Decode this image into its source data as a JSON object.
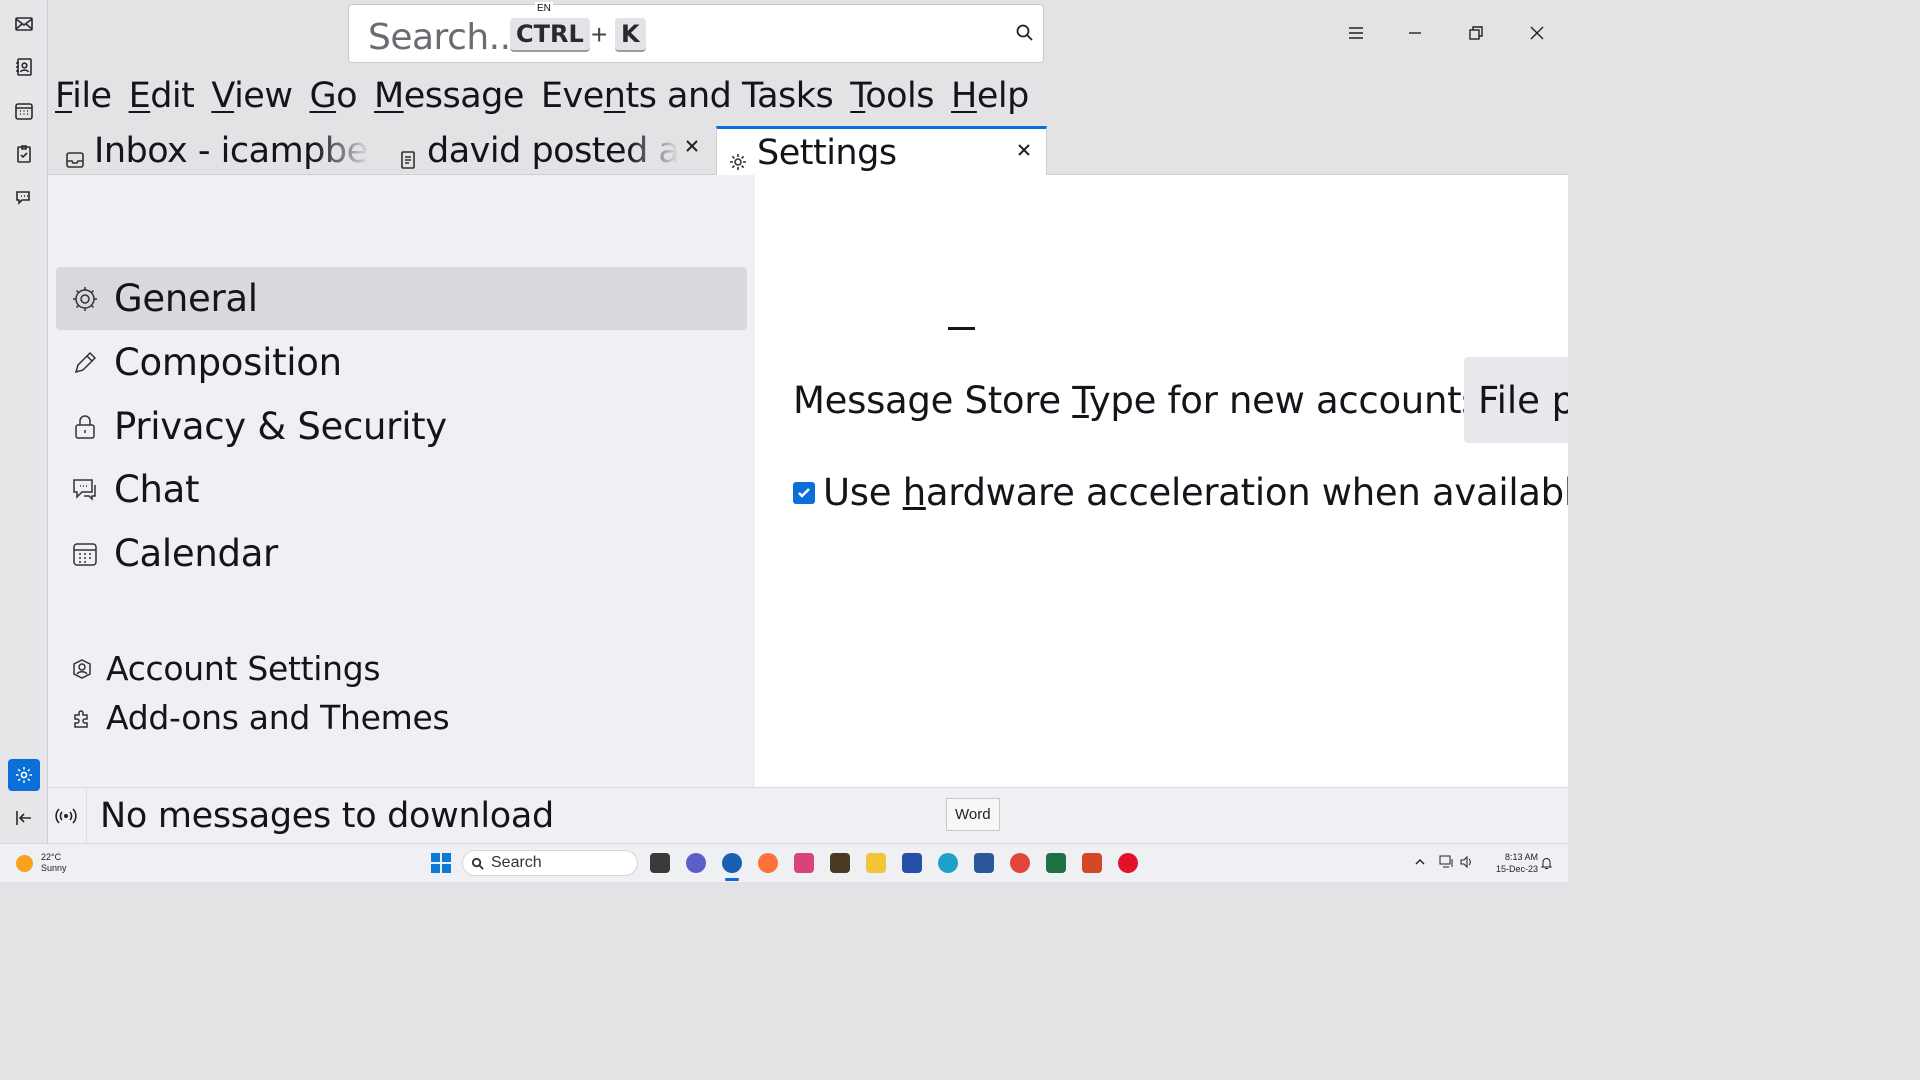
{
  "window": {
    "search_placeholder": "Search...",
    "search_key_1": "CTRL",
    "search_key_plus": "+",
    "search_key_2": "K",
    "ime_indicator": "EN"
  },
  "menubar": {
    "items": [
      {
        "pre": "",
        "u": "F",
        "post": "ile"
      },
      {
        "pre": "",
        "u": "E",
        "post": "dit"
      },
      {
        "pre": "",
        "u": "V",
        "post": "iew"
      },
      {
        "pre": "",
        "u": "G",
        "post": "o"
      },
      {
        "pre": "",
        "u": "M",
        "post": "essage"
      },
      {
        "pre": "Eve",
        "u": "n",
        "post": "ts and Tasks"
      },
      {
        "pre": "",
        "u": "T",
        "post": "ools"
      },
      {
        "pre": "",
        "u": "H",
        "post": "elp"
      }
    ]
  },
  "tabs": [
    {
      "label": "Inbox - icampbell@",
      "icon": "inbox-icon"
    },
    {
      "label": "david posted an update",
      "icon": "message-icon"
    },
    {
      "label": "Settings",
      "icon": "gear-icon"
    }
  ],
  "prefs_nav": {
    "categories": [
      "General",
      "Composition",
      "Privacy & Security",
      "Chat",
      "Calendar"
    ],
    "footer": [
      "Account Settings",
      "Add-ons and Themes"
    ]
  },
  "prefs_content": {
    "store_type": {
      "pre": "Message Store ",
      "u": "T",
      "post": "ype for new accounts:",
      "value": "File p"
    },
    "hw_accel": {
      "pre": "Use ",
      "u": "h",
      "post": "ardware acceleration when available",
      "checked": true
    }
  },
  "statusbar": {
    "text": "No messages to download",
    "tooltip": "Word"
  },
  "taskbar": {
    "weather_temp": "22°C",
    "weather_desc": "Sunny",
    "search_label": "Search",
    "time": "8:13 AM",
    "date": "15-Dec-23"
  },
  "colors": {
    "accent": "#0b6fd8",
    "selected_category_bg": "#d9d9dd",
    "nav_bg": "#f0f0f4"
  }
}
